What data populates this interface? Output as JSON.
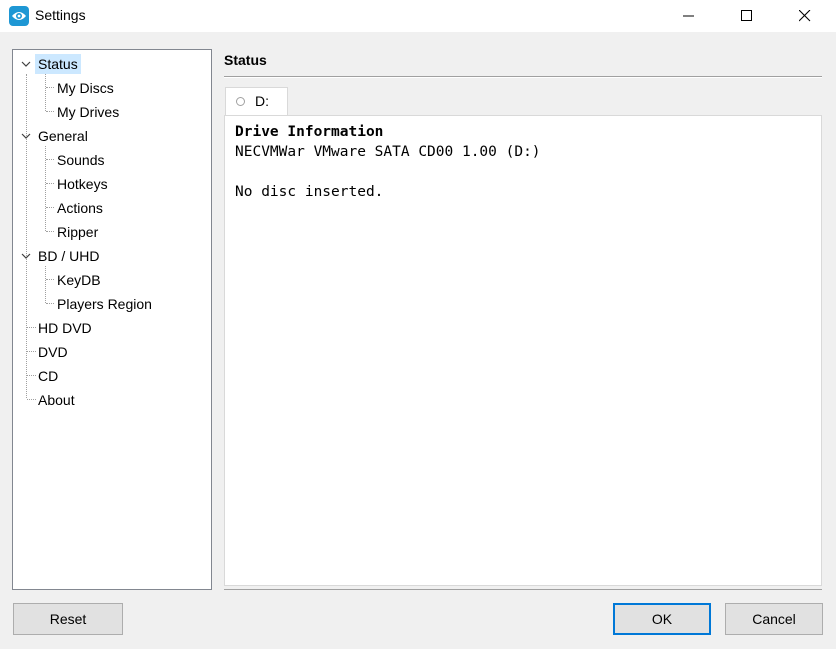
{
  "window": {
    "title": "Settings",
    "icon": "eye-icon",
    "controls": [
      "minimize-icon",
      "maximize-icon",
      "close-icon"
    ]
  },
  "tree": {
    "items": [
      {
        "label": "Status",
        "selected": true
      },
      {
        "label": "My Discs"
      },
      {
        "label": "My Drives"
      },
      {
        "label": "General"
      },
      {
        "label": "Sounds"
      },
      {
        "label": "Hotkeys"
      },
      {
        "label": "Actions"
      },
      {
        "label": "Ripper"
      },
      {
        "label": "BD / UHD"
      },
      {
        "label": "KeyDB"
      },
      {
        "label": "Players Region"
      },
      {
        "label": "HD DVD"
      },
      {
        "label": "DVD"
      },
      {
        "label": "CD"
      },
      {
        "label": "About"
      }
    ]
  },
  "status": {
    "title": "Status",
    "tab_label": "D:",
    "heading": "Drive Information",
    "drive_line": "NECVMWar VMware SATA CD00 1.00 (D:)",
    "message": "No disc inserted."
  },
  "buttons": {
    "reset": "Reset",
    "ok": "OK",
    "cancel": "Cancel"
  },
  "colors": {
    "accent": "#0078d7",
    "selection": "#cce8ff",
    "app_icon": "#1e97d4"
  }
}
